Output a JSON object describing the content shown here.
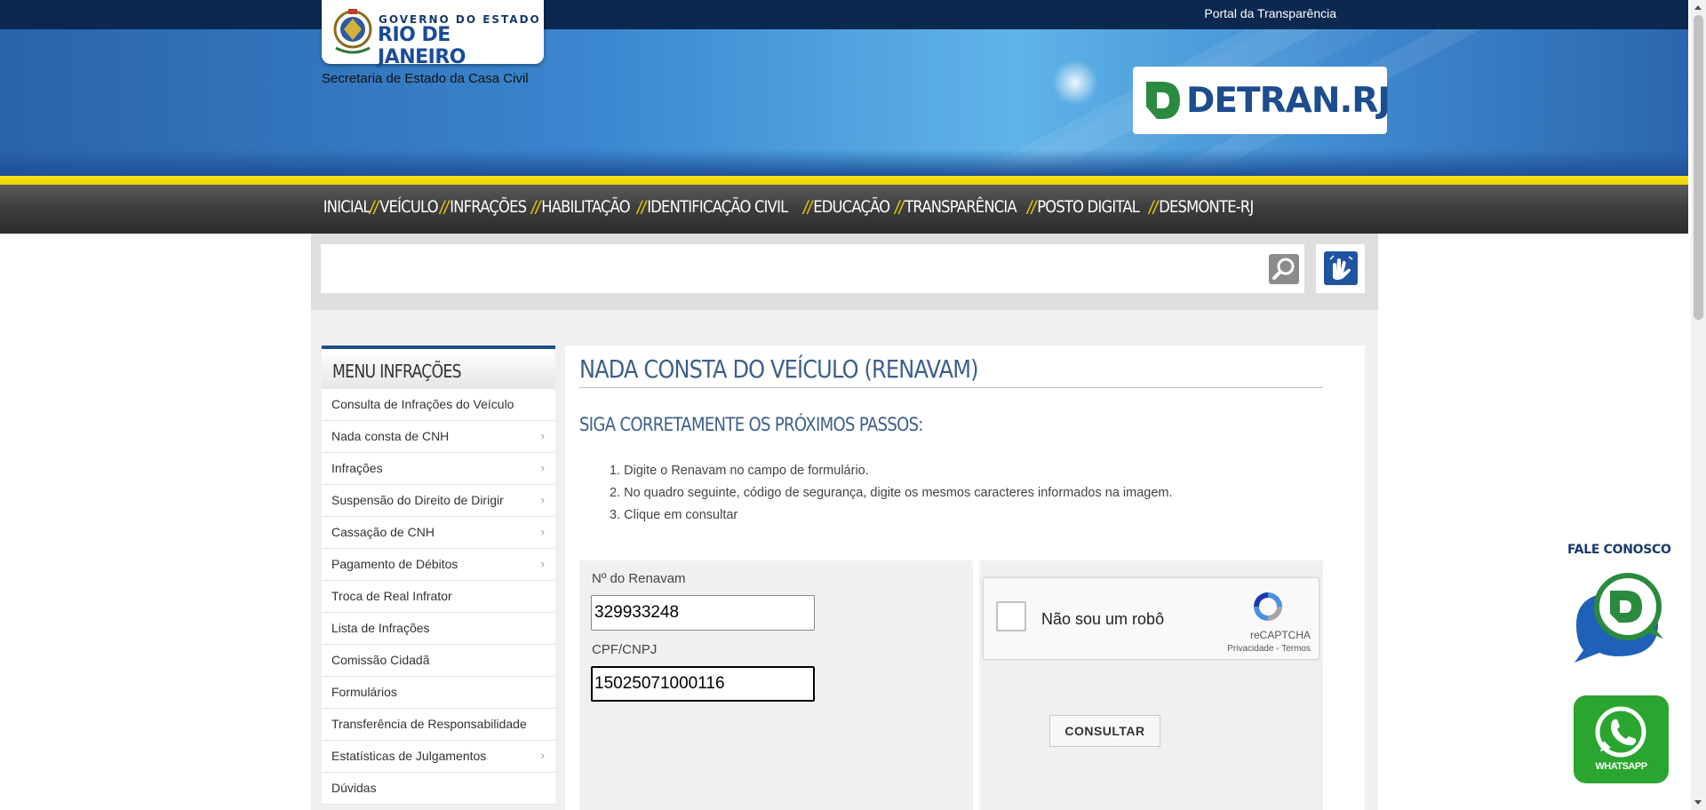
{
  "header": {
    "portal_link": "Portal da Transparência",
    "gov_logo_line1": "GOVERNO DO ESTADO",
    "gov_logo_line2": "RIO DE JANEIRO",
    "secretaria": "Secretaria de Estado da Casa Civil",
    "detran_logo": "DETRAN.RJ"
  },
  "nav": {
    "items": [
      {
        "label": "INICIAL",
        "prefix": ""
      },
      {
        "label": "VEÍCULO",
        "prefix": "//"
      },
      {
        "label": "INFRAÇÕES",
        "prefix": "//"
      },
      {
        "label": "HABILITAÇÃO",
        "prefix": "//"
      },
      {
        "label": "IDENTIFICAÇÃO CIVIL",
        "prefix": "//"
      },
      {
        "label": "EDUCAÇÃO",
        "prefix": "//"
      },
      {
        "label": "TRANSPARÊNCIA",
        "prefix": "//"
      },
      {
        "label": "POSTO DIGITAL",
        "prefix": "//"
      },
      {
        "label": "DESMONTE-RJ",
        "prefix": "//"
      }
    ]
  },
  "search": {
    "value": "",
    "icon": "search-icon",
    "accessibility_icon": "sign-language-icon"
  },
  "sidebar": {
    "title": "MENU INFRAÇÕES",
    "items": [
      {
        "label": "Consulta de Infrações do Veículo",
        "chevron": ""
      },
      {
        "label": "Nada consta de CNH",
        "chevron": "›"
      },
      {
        "label": "Infrações",
        "chevron": "›"
      },
      {
        "label": "Suspensão do Direito de Dirigir",
        "chevron": "›"
      },
      {
        "label": "Cassação de CNH",
        "chevron": "›"
      },
      {
        "label": "Pagamento de Débitos",
        "chevron": "›"
      },
      {
        "label": "Troca de Real Infrator",
        "chevron": ""
      },
      {
        "label": "Lista de Infrações",
        "chevron": ""
      },
      {
        "label": "Comissão Cidadã",
        "chevron": ""
      },
      {
        "label": "Formulários",
        "chevron": ""
      },
      {
        "label": "Transferência de Responsabilidade",
        "chevron": ""
      },
      {
        "label": "Estatísticas de Julgamentos",
        "chevron": "›"
      },
      {
        "label": "Dúvidas",
        "chevron": ""
      }
    ]
  },
  "main": {
    "title": "NADA CONSTA DO VEÍCULO (RENAVAM)",
    "subtitle": "SIGA CORRETAMENTE OS PRÓXIMOS PASSOS:",
    "steps": [
      "1. Digite o Renavam no campo de formulário.",
      "2. No quadro seguinte, código de segurança, digite os mesmos caracteres informados na imagem.",
      "3. Clique em consultar"
    ]
  },
  "form": {
    "renavam_label": "Nº do Renavam",
    "renavam_value": "329933248",
    "cpf_label": "CPF/CNPJ",
    "cpf_value": "15025071000116",
    "captcha_text": "Não sou um robô",
    "captcha_brand": "reCAPTCHA",
    "captcha_terms": "Privacidade - Termos",
    "submit_label": "CONSULTAR"
  },
  "widgets": {
    "fale_conosco": "FALE CONOSCO",
    "whatsapp": "WHATSAPP"
  },
  "colors": {
    "topbar": "#0c2850",
    "nav_accent": "#f3d400",
    "title": "#3d5f8c",
    "whatsapp": "#2aa52f"
  }
}
